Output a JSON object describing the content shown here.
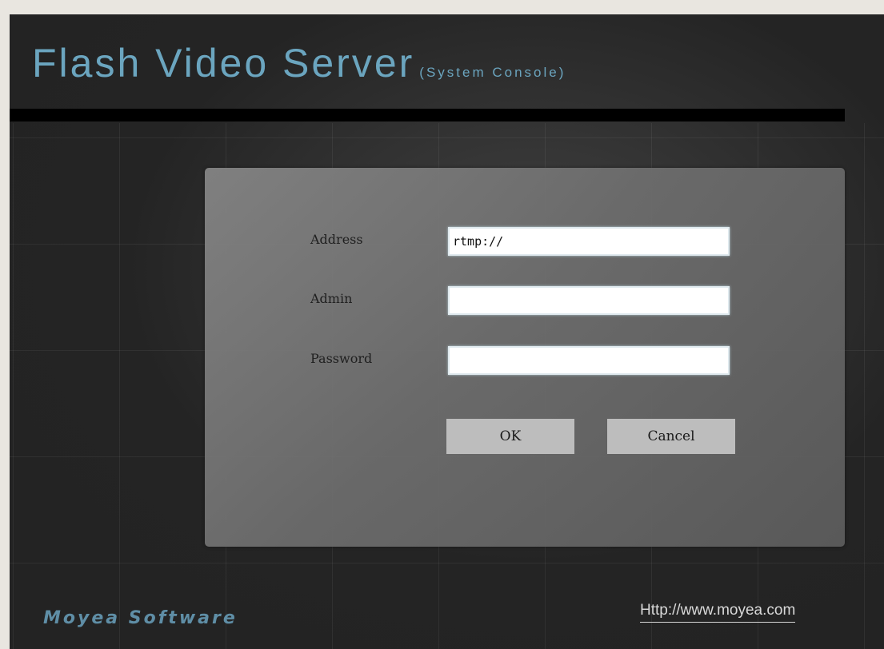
{
  "header": {
    "title": "Flash Video Server",
    "subtitle": "(System Console)"
  },
  "login": {
    "address_label": "Address",
    "address_value": "rtmp://",
    "admin_label": "Admin",
    "admin_value": "",
    "password_label": "Password",
    "password_value": "",
    "ok_label": "OK",
    "cancel_label": "Cancel"
  },
  "footer": {
    "brand": "Moyea Software",
    "link": "Http://www.moyea.com"
  },
  "colors": {
    "title": "#6ba5bf",
    "brand": "#5f8ea6",
    "panel": "#7a7a7a",
    "background": "#232323",
    "button": "#bdbdbd"
  }
}
